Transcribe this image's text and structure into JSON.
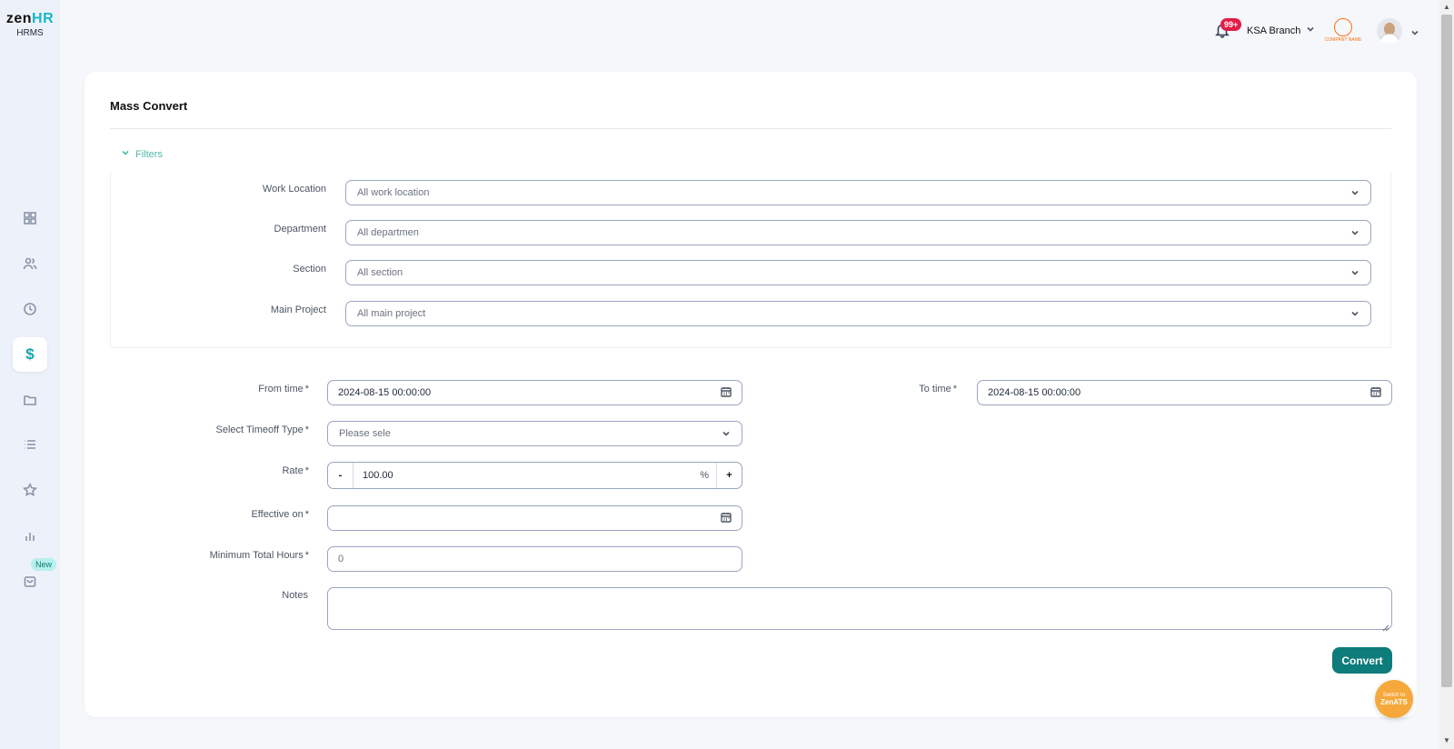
{
  "brand": {
    "logo_zen": "zen",
    "logo_hr": "HR",
    "product": "HRMS"
  },
  "sidebar": {
    "items": [
      {
        "name": "dashboard",
        "icon": "grid-icon"
      },
      {
        "name": "employees",
        "icon": "users-icon"
      },
      {
        "name": "time",
        "icon": "clock-icon"
      },
      {
        "name": "payroll",
        "icon": "dollar-icon",
        "active": true,
        "glyph": "$"
      },
      {
        "name": "documents",
        "icon": "folder-icon"
      },
      {
        "name": "lists",
        "icon": "list-icon"
      },
      {
        "name": "performance",
        "icon": "star-icon"
      },
      {
        "name": "reports",
        "icon": "bar-chart-icon"
      },
      {
        "name": "marketplace",
        "icon": "bag-icon",
        "badge": "New"
      }
    ]
  },
  "topbar": {
    "notifications_count": "99+",
    "branch": "KSA Branch",
    "company_logo_text": "COMPANY NAME"
  },
  "page": {
    "title": "Mass Convert",
    "filters_label": "Filters",
    "filters": [
      {
        "label": "Work Location",
        "value": "All work location"
      },
      {
        "label": "Department",
        "value": "All departmen"
      },
      {
        "label": "Section",
        "value": "All section"
      },
      {
        "label": "Main Project",
        "value": "All main project"
      }
    ],
    "form": {
      "from_time": {
        "label": "From time",
        "required": "*",
        "value": "2024-08-15 00:00:00"
      },
      "to_time": {
        "label": "To time",
        "required": "*",
        "value": "2024-08-15 00:00:00"
      },
      "timeoff_type": {
        "label": "Select Timeoff Type",
        "required": "*",
        "placeholder": "Please sele"
      },
      "rate": {
        "label": "Rate",
        "required": "*",
        "value": "100.00",
        "unit": "%",
        "minus": "-",
        "plus": "+"
      },
      "effective_on": {
        "label": "Effective on",
        "required": "*",
        "value": ""
      },
      "min_hours": {
        "label": "Minimum Total Hours",
        "required": "*",
        "value": "0"
      },
      "notes": {
        "label": "Notes",
        "value": ""
      }
    },
    "convert_button": "Convert"
  },
  "switch_ats": {
    "line1": "Switch to",
    "line2": "ZenATS"
  },
  "colors": {
    "accent": "#0e7c7b",
    "brand_hr": "#18b7c7",
    "badge": "#e11d48",
    "ats": "#f7a83a"
  }
}
